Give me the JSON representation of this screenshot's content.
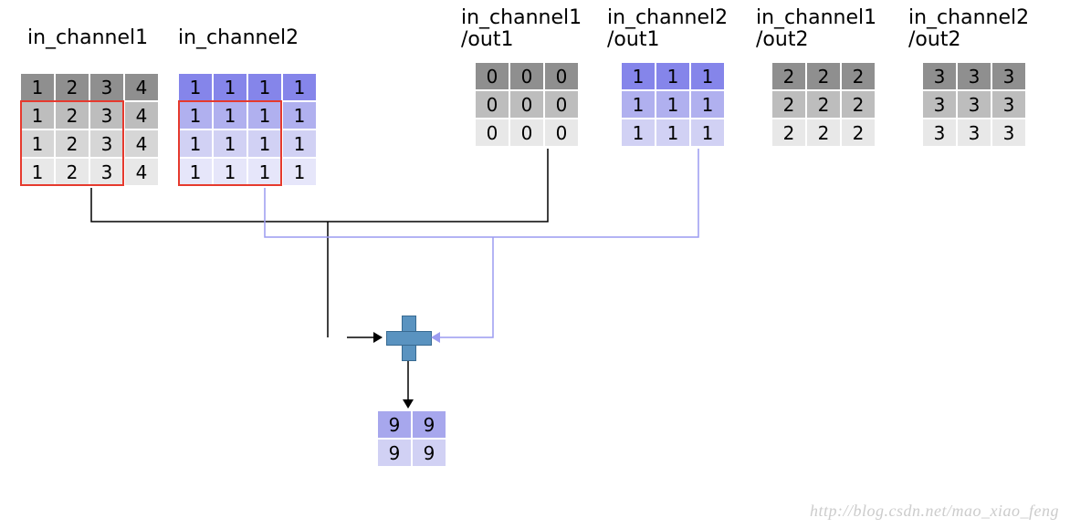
{
  "labels": {
    "in1": "in_channel1",
    "in2": "in_channel2",
    "k1": "in_channel1\n/out1",
    "k2": "in_channel2\n/out1",
    "k3": "in_channel1\n/out2",
    "k4": "in_channel2\n/out2"
  },
  "watermark": "http://blog.csdn.net/mao_xiao_feng",
  "colors": {
    "gray": [
      "#8f8f8f",
      "#bdbdbd",
      "#d6d6d6",
      "#e8e8e8"
    ],
    "purple": [
      "#8585ea",
      "#b0b0ef",
      "#d1d1f4",
      "#e6e6fa"
    ],
    "purple3": [
      "#8585ea",
      "#b0b0ef",
      "#d1d1f4"
    ],
    "gray3": [
      "#8f8f8f",
      "#bdbdbd",
      "#e8e8e8"
    ],
    "out2": [
      "#a7a7ed",
      "#d1d1f4"
    ]
  },
  "grids": {
    "in1": {
      "cols": 4,
      "rowColorKey": "gray",
      "data": [
        [
          1,
          2,
          3,
          4
        ],
        [
          1,
          2,
          3,
          4
        ],
        [
          1,
          2,
          3,
          4
        ],
        [
          1,
          2,
          3,
          4
        ]
      ]
    },
    "in2": {
      "cols": 4,
      "rowColorKey": "purple",
      "data": [
        [
          1,
          1,
          1,
          1
        ],
        [
          1,
          1,
          1,
          1
        ],
        [
          1,
          1,
          1,
          1
        ],
        [
          1,
          1,
          1,
          1
        ]
      ]
    },
    "k1": {
      "cols": 3,
      "rowColorKey": "gray3",
      "data": [
        [
          0,
          0,
          0
        ],
        [
          0,
          0,
          0
        ],
        [
          0,
          0,
          0
        ]
      ]
    },
    "k2": {
      "cols": 3,
      "rowColorKey": "purple3",
      "data": [
        [
          1,
          1,
          1
        ],
        [
          1,
          1,
          1
        ],
        [
          1,
          1,
          1
        ]
      ]
    },
    "k3": {
      "cols": 3,
      "rowColorKey": "gray3",
      "data": [
        [
          2,
          2,
          2
        ],
        [
          2,
          2,
          2
        ],
        [
          2,
          2,
          2
        ]
      ]
    },
    "k4": {
      "cols": 3,
      "rowColorKey": "gray3",
      "data": [
        [
          3,
          3,
          3
        ],
        [
          3,
          3,
          3
        ],
        [
          3,
          3,
          3
        ]
      ]
    },
    "out": {
      "cols": 2,
      "rowColorKey": "out2",
      "data": [
        [
          9,
          9
        ],
        [
          9,
          9
        ]
      ]
    }
  },
  "chart_data": {
    "type": "table",
    "note": "Depthwise/multi-channel convolution diagram: two 4×4 input channels, four 3×3 kernels (in_ch × out_ch), one 2×2 output feature map (out1). Red boxes mark the 3×3 sliding window at bottom-left position.",
    "inputs": {
      "in_channel1": [
        [
          1,
          2,
          3,
          4
        ],
        [
          1,
          2,
          3,
          4
        ],
        [
          1,
          2,
          3,
          4
        ],
        [
          1,
          2,
          3,
          4
        ]
      ],
      "in_channel2": [
        [
          1,
          1,
          1,
          1
        ],
        [
          1,
          1,
          1,
          1
        ],
        [
          1,
          1,
          1,
          1
        ],
        [
          1,
          1,
          1,
          1
        ]
      ]
    },
    "kernels": {
      "in_channel1/out1": [
        [
          0,
          0,
          0
        ],
        [
          0,
          0,
          0
        ],
        [
          0,
          0,
          0
        ]
      ],
      "in_channel2/out1": [
        [
          1,
          1,
          1
        ],
        [
          1,
          1,
          1
        ],
        [
          1,
          1,
          1
        ]
      ],
      "in_channel1/out2": [
        [
          2,
          2,
          2
        ],
        [
          2,
          2,
          2
        ],
        [
          2,
          2,
          2
        ]
      ],
      "in_channel2/out2": [
        [
          3,
          3,
          3
        ],
        [
          3,
          3,
          3
        ],
        [
          3,
          3,
          3
        ]
      ]
    },
    "output_out1": [
      [
        9,
        9
      ],
      [
        9,
        9
      ]
    ],
    "highlight_window": {
      "rows": "1-3 (0-indexed)",
      "cols": "0-2"
    }
  }
}
